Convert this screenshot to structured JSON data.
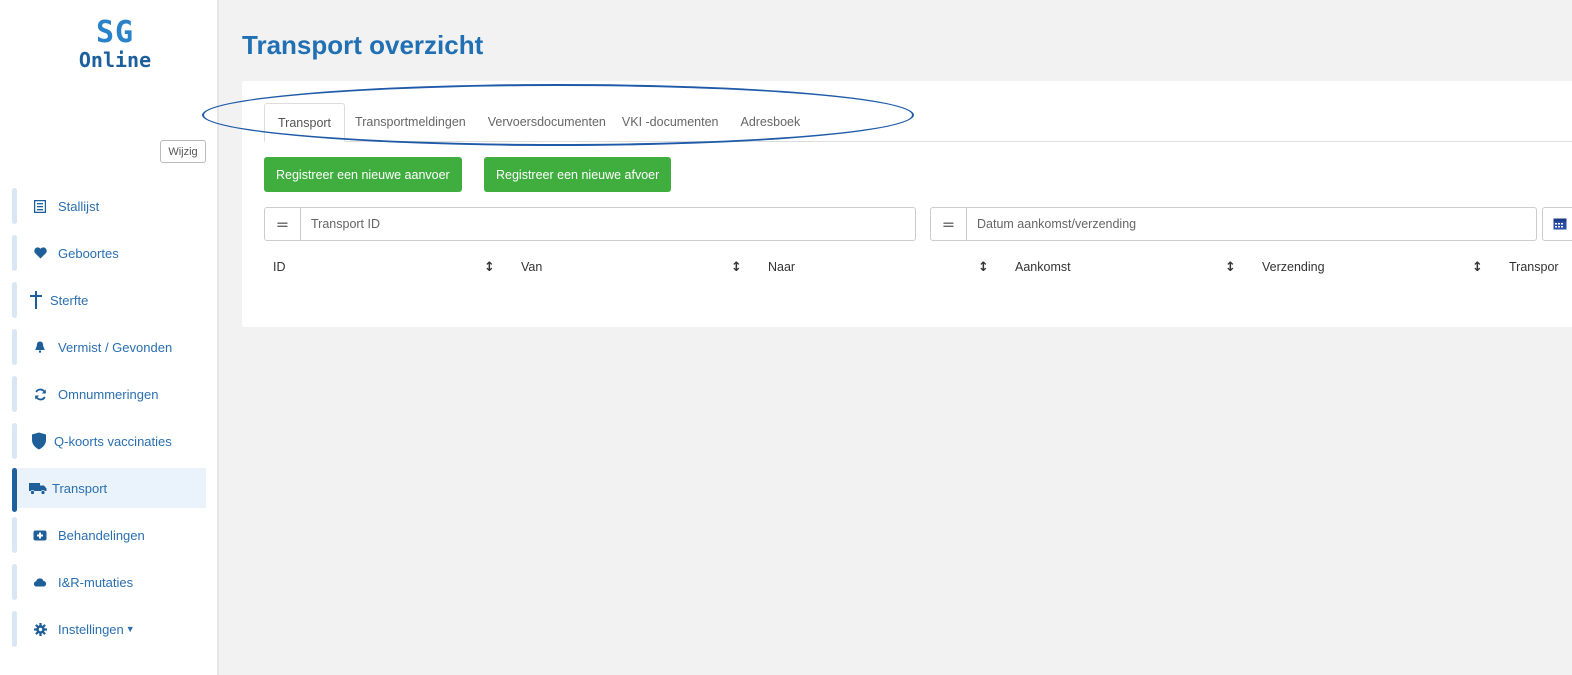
{
  "logo": {
    "line1": "SG",
    "line2": "Online"
  },
  "sidebar": {
    "edit_label": "Wijzig",
    "items": [
      {
        "label": "Stallijst",
        "icon": "list-icon"
      },
      {
        "label": "Geboortes",
        "icon": "heart-icon"
      },
      {
        "label": "Sterfte",
        "icon": "cross-icon"
      },
      {
        "label": "Vermist / Gevonden",
        "icon": "bell-icon"
      },
      {
        "label": "Omnummeringen",
        "icon": "refresh-icon"
      },
      {
        "label": "Q-koorts vaccinaties",
        "icon": "shield-icon"
      },
      {
        "label": "Transport",
        "icon": "truck-icon",
        "active": true
      },
      {
        "label": "Behandelingen",
        "icon": "medicine-icon"
      },
      {
        "label": "I&R-mutaties",
        "icon": "cloud-icon"
      },
      {
        "label": "Instellingen",
        "icon": "gear-icon",
        "has_caret": true
      }
    ]
  },
  "main": {
    "title": "Transport overzicht",
    "tabs": [
      {
        "label": "Transport",
        "active": true
      },
      {
        "label": "Transportmeldingen"
      },
      {
        "label": "Vervoersdocumenten"
      },
      {
        "label": "VKI -documenten"
      },
      {
        "label": "Adresboek"
      }
    ],
    "buttons": {
      "new_arrival": "Registreer een nieuwe aanvoer",
      "new_departure": "Registreer een nieuwe afvoer"
    },
    "filters": {
      "operator_symbol": "=",
      "transport_id_placeholder": "Transport ID",
      "date_placeholder": "Datum aankomst/verzending"
    },
    "table": {
      "columns": [
        "ID",
        "Van",
        "Naar",
        "Aankomst",
        "Verzending",
        "Transpor"
      ],
      "sort_symbol": "↕"
    }
  },
  "colors": {
    "accent": "#2170b3",
    "green": "#3fae3f",
    "annotation": "#1e5aa8"
  }
}
